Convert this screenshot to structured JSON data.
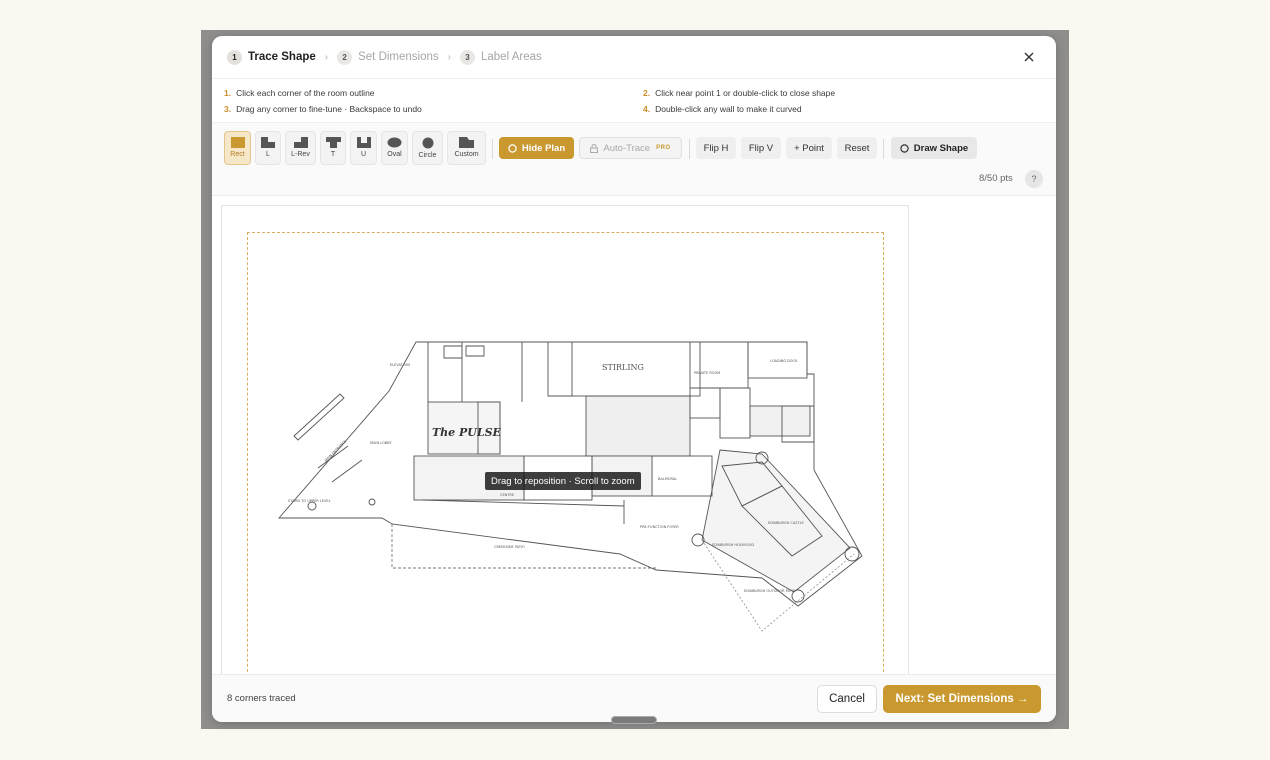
{
  "steps": [
    {
      "num": "1",
      "label": "Trace Shape"
    },
    {
      "num": "2",
      "label": "Set Dimensions"
    },
    {
      "num": "3",
      "label": "Label Areas"
    }
  ],
  "instructions": [
    {
      "num": "1.",
      "text": "Click each corner of the room outline"
    },
    {
      "num": "2.",
      "text": "Click near point 1 or double-click to close shape"
    },
    {
      "num": "3.",
      "text": "Drag any corner to fine-tune · Backspace to undo"
    },
    {
      "num": "4.",
      "text": "Double-click any wall to make it curved"
    }
  ],
  "shapes": [
    {
      "label": "Rect",
      "icon": "rect-shape-icon"
    },
    {
      "label": "L",
      "icon": "l-shape-icon"
    },
    {
      "label": "L-Rev",
      "icon": "l-rev-shape-icon"
    },
    {
      "label": "T",
      "icon": "t-shape-icon"
    },
    {
      "label": "U",
      "icon": "u-shape-icon"
    },
    {
      "label": "Oval",
      "icon": "oval-shape-icon"
    },
    {
      "label": "Circle",
      "icon": "circle-shape-icon"
    },
    {
      "label": "Custom",
      "icon": "custom-shape-icon"
    }
  ],
  "toolbar": {
    "hide_plan": "Hide Plan",
    "auto_trace": "Auto-Trace",
    "pro_badge": "PRO",
    "flip_h": "Flip H",
    "flip_v": "Flip V",
    "add_point": "+ Point",
    "reset": "Reset",
    "draw_shape": "Draw Shape",
    "points": "8/50 pts",
    "help": "?"
  },
  "canvas": {
    "tooltip": "Drag to reposition · Scroll to zoom",
    "plan_labels": {
      "stirling": "STIRLING",
      "pulse": "The PULSE",
      "elevators": "ELEVATORS",
      "main_lobby": "MAIN LOBBY",
      "loading_dock": "LOADING DOCK",
      "private_room": "PRIVATE ROOM",
      "balmoral": "BALMORAL",
      "prefunction": "PRE-FUNCTION FOYER",
      "creekside": "CREEKSIDE PATIO",
      "edinburgh_castle": "EDINBURGH CASTLE",
      "edinburgh_holyrood": "EDINBURGH HOLYROOD",
      "edinburgh_patio": "EDINBURGH OUTDOOR PATIO",
      "stairs": "STAIRS TO UPPER LEVEL",
      "main_entrance": "MAIN ENTRANCE",
      "centre": "CENTRE"
    }
  },
  "footer": {
    "status": "8 corners traced",
    "cancel": "Cancel",
    "next": "Next: Set Dimensions →"
  },
  "colors": {
    "accent": "#c9982e",
    "trace_outline": "#d7ae62"
  }
}
